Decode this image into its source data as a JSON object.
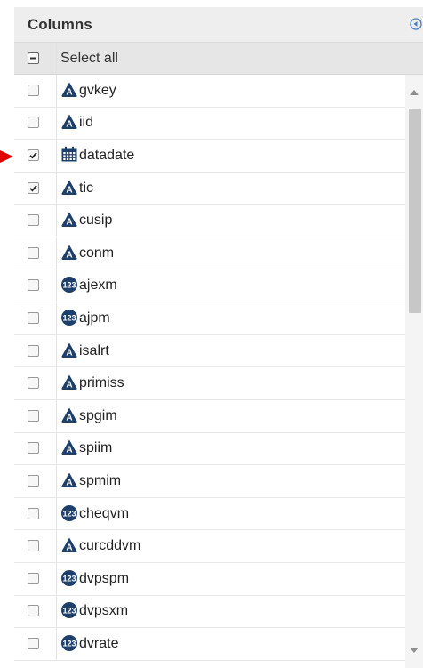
{
  "panel": {
    "title": "Columns",
    "select_all_label": "Select all"
  },
  "colors": {
    "icon": "#1d3f6a",
    "arrow": "#e00000",
    "header_bg": "#eeeeee"
  },
  "columns": [
    {
      "name": "gvkey",
      "type": "character-icon",
      "checked": false
    },
    {
      "name": "iid",
      "type": "character-icon",
      "checked": false
    },
    {
      "name": "datadate",
      "type": "date-icon",
      "checked": true
    },
    {
      "name": "tic",
      "type": "character-icon",
      "checked": true
    },
    {
      "name": "cusip",
      "type": "character-icon",
      "checked": false
    },
    {
      "name": "conm",
      "type": "character-icon",
      "checked": false
    },
    {
      "name": "ajexm",
      "type": "numeric-icon",
      "checked": false
    },
    {
      "name": "ajpm",
      "type": "numeric-icon",
      "checked": false
    },
    {
      "name": "isalrt",
      "type": "character-icon",
      "checked": false
    },
    {
      "name": "primiss",
      "type": "character-icon",
      "checked": false
    },
    {
      "name": "spgim",
      "type": "character-icon",
      "checked": false
    },
    {
      "name": "spiim",
      "type": "character-icon",
      "checked": false
    },
    {
      "name": "spmim",
      "type": "character-icon",
      "checked": false
    },
    {
      "name": "cheqvm",
      "type": "numeric-icon",
      "checked": false
    },
    {
      "name": "curcddvm",
      "type": "character-icon",
      "checked": false
    },
    {
      "name": "dvpspm",
      "type": "numeric-icon",
      "checked": false
    },
    {
      "name": "dvpsxm",
      "type": "numeric-icon",
      "checked": false
    },
    {
      "name": "dvrate",
      "type": "numeric-icon",
      "checked": false
    }
  ]
}
